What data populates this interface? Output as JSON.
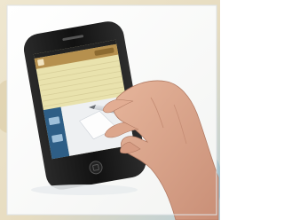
{
  "scene": {
    "subject": "hand-with-stylus-on-smartphone-notes-screen",
    "colors": {
      "frame_beige": "#e6dfc8",
      "frame_blue": "#9fbfcf",
      "panel": "#ffffff",
      "phone_body": "#1a1a1a",
      "notes_paper": "#f6eeb2",
      "notes_header": "#c9a25a",
      "sidebar": "#2f5f86",
      "skin": "#d9a58b",
      "stylus": "#b7bcc2"
    },
    "icons": {
      "app_icon": "notes-icon",
      "home_button": "home-button-icon"
    }
  }
}
